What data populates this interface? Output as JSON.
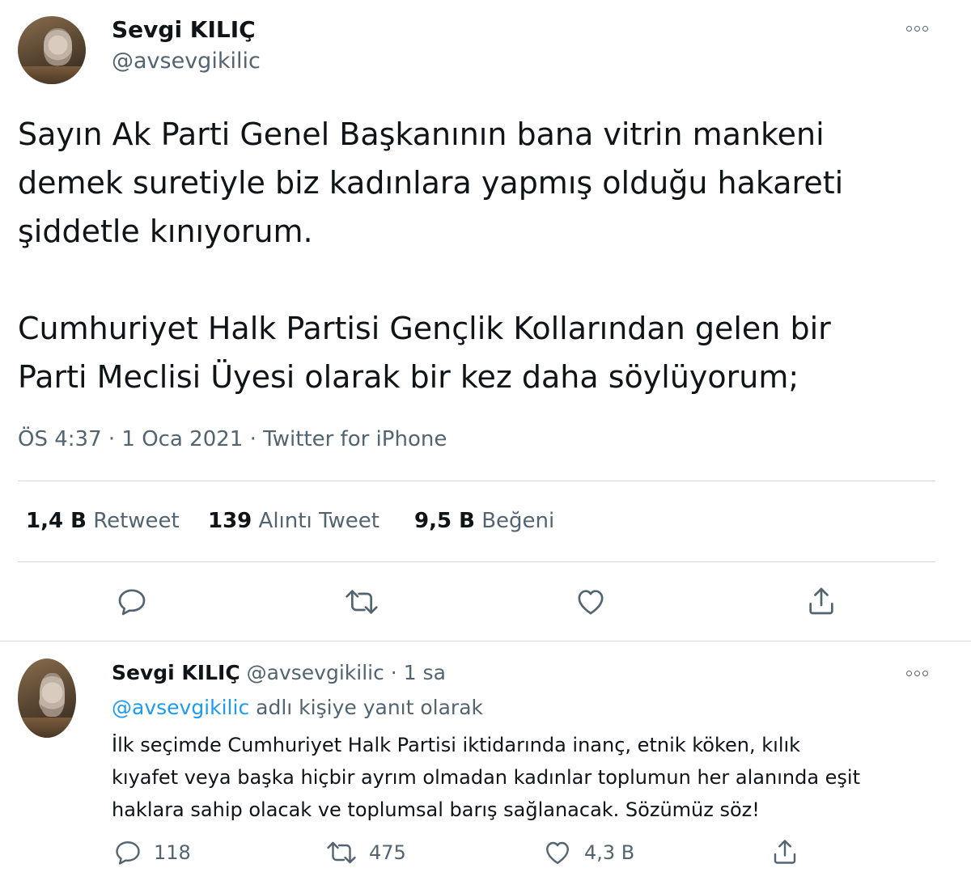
{
  "main_tweet": {
    "display_name": "Sevgi KILIÇ",
    "handle": "@avsevgikilic",
    "text_para1_line1": "Sayın Ak Parti Genel Başkanının bana vitrin mankeni",
    "text_para1_line2": "demek suretiyle biz kadınlara yapmış olduğu hakareti",
    "text_para1_line3": "şiddetle kınıyorum.",
    "text_para2_line1": "Cumhuriyet Halk Partisi Gençlik Kollarından gelen bir",
    "text_para2_line2": "Parti Meclisi Üyesi olarak bir kez daha söylüyorum;",
    "timestamp": "ÖS 4:37 · 1 Oca 2021 · Twitter for iPhone",
    "stats": {
      "retweets_count": "1,4 B",
      "retweets_label": "Retweet",
      "quotes_count": "139",
      "quotes_label": "Alıntı Tweet",
      "likes_count": "9,5 B",
      "likes_label": "Beğeni"
    },
    "actions": [
      "reply-icon",
      "retweet-icon",
      "like-icon",
      "share-icon"
    ]
  },
  "reply_tweet": {
    "display_name": "Sevgi KILIÇ",
    "handle": "@avsevgikilic",
    "separator": "·",
    "time": "1 sa",
    "replying_to_handle": "@avsevgikilic",
    "replying_to_suffix": "adlı kişiye yanıt olarak",
    "text_line1": "İlk seçimde Cumhuriyet Halk Partisi iktidarında inanç, etnik köken, kılık",
    "text_line2": "kıyafet veya başka hiçbir ayrım olmadan kadınlar toplumun her alanında eşit",
    "text_line3": "haklara sahip olacak ve toplumsal barış sağlanacak. Sözümüz söz!",
    "reply_count": "118",
    "retweet_count": "475",
    "like_count": "4,3 B"
  },
  "colors": {
    "text": "#0f1419",
    "muted": "#536471",
    "link": "#1d9bf0",
    "divider": "#cfd9de"
  }
}
